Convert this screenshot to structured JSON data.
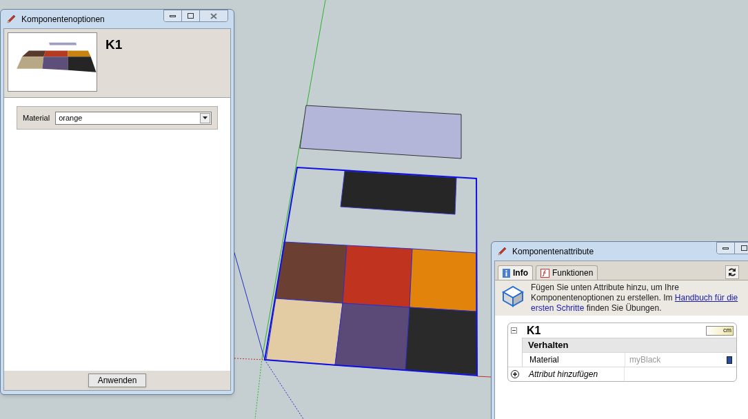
{
  "options_window": {
    "title": "Komponentenoptionen",
    "component_name": "K1",
    "fields": [
      {
        "label": "Material",
        "value": "orange"
      }
    ],
    "apply_button": "Anwenden"
  },
  "attributes_window": {
    "title": "Komponentenattribute",
    "tabs": [
      {
        "label": "Info",
        "selected": true
      },
      {
        "label": "Funktionen",
        "selected": false
      }
    ],
    "info": {
      "text_before": "Fügen Sie unten Attribute hinzu, um Ihre Komponentenoptionen zu erstellen. Im ",
      "link_lines": [
        "Handbuch für die",
        "ersten Schritte"
      ],
      "text_after": " finden Sie Übungen."
    },
    "component": {
      "name": "K1",
      "expanded": true,
      "unit": "cm",
      "section": "Verhalten",
      "attributes": [
        {
          "name": "Material",
          "value": "myBlack"
        }
      ],
      "add_row": "Attribut hinzufügen"
    }
  }
}
